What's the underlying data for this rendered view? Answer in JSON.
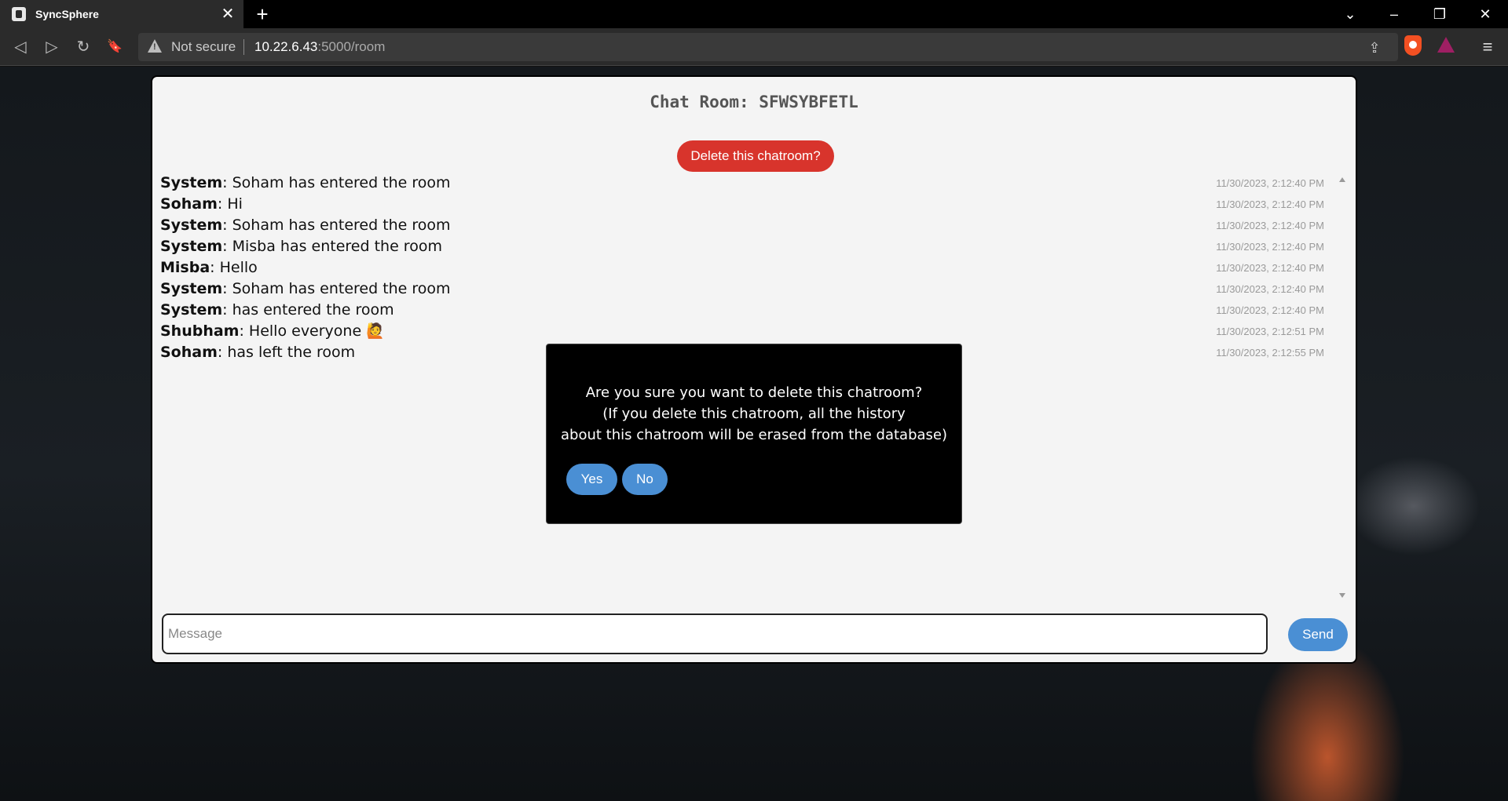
{
  "browser": {
    "tab_title": "SyncSphere",
    "tab_close": "✕",
    "new_tab": "+",
    "address_warning": "Not secure",
    "url_host": "10.22.6.43",
    "url_path": ":5000/room",
    "window_controls": {
      "dropdown": "⌄",
      "minimize": "–",
      "restore": "❐",
      "close": "✕"
    },
    "nav": {
      "back": "◁",
      "forward": "▷",
      "reload": "↻",
      "bookmark": "🔖"
    },
    "share": "⇪",
    "menu": "≡"
  },
  "room": {
    "title": "Chat Room: SFWSYBFETL",
    "delete_label": "Delete this chatroom?"
  },
  "messages": [
    {
      "sender": "System",
      "text": ": Soham has entered the room",
      "time": "11/30/2023, 2:12:40 PM"
    },
    {
      "sender": "Soham",
      "text": ": Hi",
      "time": "11/30/2023, 2:12:40 PM"
    },
    {
      "sender": "System",
      "text": ": Soham has entered the room",
      "time": "11/30/2023, 2:12:40 PM"
    },
    {
      "sender": "System",
      "text": ": Misba has entered the room",
      "time": "11/30/2023, 2:12:40 PM"
    },
    {
      "sender": "Misba",
      "text": ": Hello",
      "time": "11/30/2023, 2:12:40 PM"
    },
    {
      "sender": "System",
      "text": ": Soham has entered the room",
      "time": "11/30/2023, 2:12:40 PM"
    },
    {
      "sender": "System",
      "text": ": has entered the room",
      "time": "11/30/2023, 2:12:40 PM"
    },
    {
      "sender": "Shubham",
      "text": ": Hello everyone 🙋",
      "time": "11/30/2023, 2:12:51 PM"
    },
    {
      "sender": "Soham",
      "text": ": has left the room",
      "time": "11/30/2023, 2:12:55 PM"
    }
  ],
  "composer": {
    "placeholder": "Message",
    "value": "",
    "send_label": "Send"
  },
  "modal": {
    "line1": "Are you sure you want to delete this chatroom?",
    "line2": "(If you delete this chatroom, all the history",
    "line3": "about this chatroom will be erased from the database)",
    "yes_label": "Yes",
    "no_label": "No"
  },
  "colors": {
    "danger": "#d8342c",
    "primary": "#4a8fd4",
    "card_bg": "#f4f4f4",
    "modal_bg": "#000000"
  }
}
